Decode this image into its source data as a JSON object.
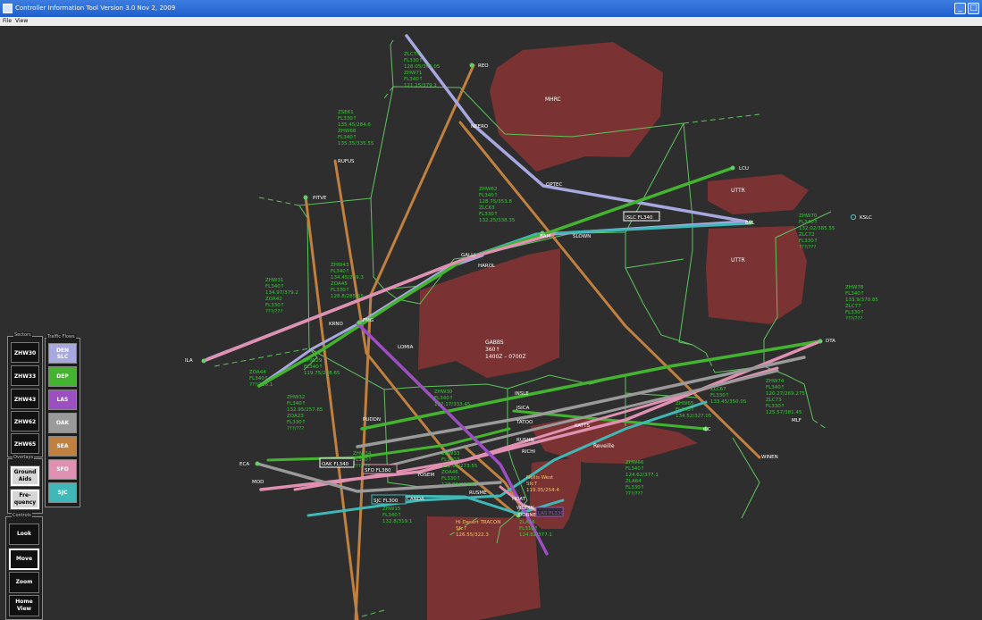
{
  "window": {
    "title": "Controller Information Tool  Version 3.0  Nov 2, 2009"
  },
  "menu": {
    "file": "File",
    "view": "View"
  },
  "colors": {
    "background": "#2e2e2e",
    "sector_line": "#5ec45e",
    "restricted_area": "#7a3232",
    "datablock": "#33cc33",
    "fix_label": "#ffffff"
  },
  "sectors_panel": {
    "caption": "Sectors",
    "buttons": [
      "ZHW30",
      "ZHW33",
      "ZHW43",
      "ZHW62",
      "ZHW65"
    ]
  },
  "flows_panel": {
    "caption": "Traffic Flows",
    "buttons": [
      {
        "top": "DEN",
        "bottom": "SLC",
        "color": "#a8a8e0"
      },
      {
        "top": "DEP",
        "bottom": "",
        "color": "#44b430"
      },
      {
        "top": "LAS",
        "bottom": "",
        "color": "#9b4fc0"
      },
      {
        "top": "OAK",
        "bottom": "",
        "color": "#9a9a9a"
      },
      {
        "top": "SEA",
        "bottom": "",
        "color": "#c08040"
      },
      {
        "top": "SFO",
        "bottom": "",
        "color": "#e090b0"
      },
      {
        "top": "SJC",
        "bottom": "",
        "color": "#40b8b8"
      }
    ]
  },
  "overlays_panel": {
    "caption": "Overlays",
    "buttons": [
      {
        "line1": "Ground",
        "line2": "Aids"
      },
      {
        "line1": "Fre-",
        "line2": "quency"
      }
    ]
  },
  "controls_panel": {
    "caption": "Controls",
    "buttons": [
      {
        "line1": "Look",
        "line2": "",
        "active": false
      },
      {
        "line1": "Move",
        "line2": "",
        "active": true
      },
      {
        "line1": "Zoom",
        "line2": "",
        "active": false
      },
      {
        "line1": "Home",
        "line2": "View",
        "active": false
      }
    ]
  },
  "areas": {
    "mhrc": "MHRC",
    "uttr1": "UTTR",
    "uttr2": "UTTR",
    "gabbs1": "GABBS",
    "gabbs2": "360↑",
    "gabbs3": "1400Z – 0700Z",
    "reveille": "Reveille"
  },
  "fixes": {
    "reo": "REO",
    "neero": "NEERO",
    "rufus": "RUFUS",
    "optec": "OPTEC",
    "lcu": "LCU",
    "pitve": "PITVE",
    "bam": "BAM",
    "slown": "SLOWN",
    "bvl": "BVL",
    "kslc": "KSLC",
    "galli": "GALLI",
    "harol": "HAROL",
    "krno": "KRNO",
    "fmg": "FMG",
    "lomia": "LOMIA",
    "ila": "ILA",
    "dta": "DTA",
    "insle": "INSLE",
    "jsica": "JSICA",
    "puddn": "PUDDN",
    "tatoo": "TATOO",
    "katts": "KATTS",
    "ilc": "ILC",
    "mlf": "MLF",
    "rushn": "RUSHN",
    "richi": "RICHI",
    "winen": "WINEN",
    "eca": "ECA",
    "mod": "MOD",
    "yosem": "YOSEM",
    "rusme": "RUSME",
    "canda": "CANDA",
    "hdat": "HDAT",
    "wodin": "WODIN",
    "dobne": "DOBNE"
  },
  "route_tags": {
    "islc": "ISLC FL340",
    "oak": "OAK FL340",
    "sfo": "SFO FL380",
    "sjc": "SJC FL300",
    "las": "LAS FL330"
  },
  "datablocks": {
    "zlc75": [
      "ZLC75",
      "FL330↑",
      "128.05/363.05",
      "ZHW71",
      "FL340↑",
      "121.15/379.1"
    ],
    "zse61": [
      "ZSE61",
      "FL330↑",
      "135.45/284.6",
      "ZHW68",
      "FL340↑",
      "135.35/335.55"
    ],
    "zhw62": [
      "ZHW62",
      "FL340↑",
      "128.75/353.8",
      "ZLC63",
      "FL330↑",
      "132.25/338.35"
    ],
    "zhw70": [
      "ZHW70",
      "FL340↑",
      "132.02/385.55",
      "ZLC72",
      "FL330↑",
      "???/???"
    ],
    "zhw31": [
      "ZHW31",
      "FL340↑",
      "134.97/379.2",
      "ZOA42",
      "FL330↑",
      "???/???"
    ],
    "zhw43": [
      "ZHW43",
      "FL340↑",
      "134.45/269.3",
      "ZOA45",
      "FL330↑",
      "128.8/285.55"
    ],
    "zhw78": [
      "ZHW78",
      "FL340↑",
      "133.9/370.85",
      "ZLC77",
      "FL330↑",
      "???/???"
    ],
    "zhw29": [
      "ZHW29",
      "FL340↑",
      "119.75/278.65"
    ],
    "zoa44": [
      "ZOA44",
      "FL340↑",
      "???/316.1"
    ],
    "zhw32": [
      "ZHW32",
      "FL340↑",
      "132.95/257.85",
      "ZOA23",
      "FL330↑",
      "???/???"
    ],
    "zhw30": [
      "ZHW30",
      "FL340↑",
      "127.17/333.45"
    ],
    "zlc67": [
      "ZLC67",
      "FL330↑",
      "133.45/350.05"
    ],
    "zhw65": [
      "ZHW65",
      "FL340↑",
      "134.52/327.05"
    ],
    "zhw74": [
      "ZHW74",
      "FL340↑",
      "120.27/269.275",
      "ZLC73",
      "FL330↑",
      "125.57/381.45"
    ],
    "zhw34": [
      "ZHW34",
      "FL340↑",
      "???/???"
    ],
    "zhw33": [
      "ZHW33",
      "FL340↑",
      "132.05/273.55",
      "ZOA46",
      "FL330↑",
      "128.95/284.65"
    ],
    "nellis": [
      "Nellis West",
      "Sfc↑",
      "119.35/254.4"
    ],
    "zhw66": [
      "ZHW66",
      "FL340↑",
      "124.62/377.1",
      "ZLA64",
      "FL330↑",
      "???/???"
    ],
    "zhw15": [
      "ZHW15",
      "FL340↑",
      "132.8/319.1"
    ],
    "hidesert": [
      "Hi Desert TRACON",
      "Sfc↑",
      "126.55/322.3"
    ],
    "zla16": [
      "ZLA16",
      "FL310↑",
      "124.82/377.1"
    ]
  }
}
